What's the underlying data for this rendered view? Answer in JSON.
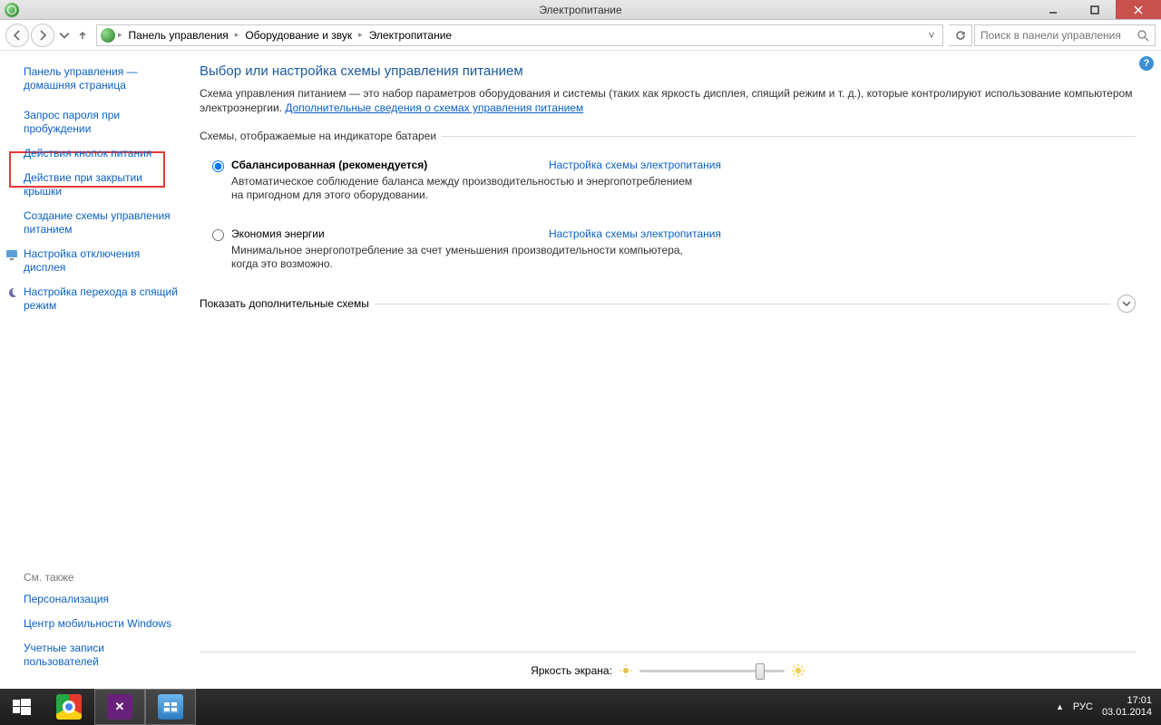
{
  "window": {
    "title": "Электропитание"
  },
  "breadcrumb": {
    "root": "Панель управления",
    "mid": "Оборудование и звук",
    "leaf": "Электропитание"
  },
  "search": {
    "placeholder": "Поиск в панели управления"
  },
  "sidebar": {
    "home": "Панель управления — домашняя страница",
    "items": [
      "Запрос пароля при пробуждении",
      "Действия кнопок питания",
      "Действие при закрытии крышки",
      "Создание схемы управления питанием",
      "Настройка отключения дисплея",
      "Настройка перехода в спящий режим"
    ],
    "see_also_hdr": "См. также",
    "see_also": [
      "Персонализация",
      "Центр мобильности Windows",
      "Учетные записи пользователей"
    ]
  },
  "main": {
    "title": "Выбор или настройка схемы управления питанием",
    "desc": "Схема управления питанием — это набор параметров оборудования и системы (таких как яркость дисплея, спящий режим и т. д.), которые контролируют использование компьютером электроэнергии.",
    "more_link": "Дополнительные сведения о схемах управления питанием",
    "legend": "Схемы, отображаемые на индикаторе батареи",
    "plans": [
      {
        "name": "Сбалансированная (рекомендуется)",
        "link": "Настройка схемы электропитания",
        "desc": "Автоматическое соблюдение баланса между производительностью и энергопотреблением на пригодном для этого оборудовании.",
        "selected": true
      },
      {
        "name": "Экономия энергии",
        "link": "Настройка схемы электропитания",
        "desc": "Минимальное энергопотребление за счет уменьшения производительности компьютера, когда это возможно.",
        "selected": false
      }
    ],
    "extra_label": "Показать дополнительные схемы",
    "brightness_label": "Яркость экрана:"
  },
  "taskbar": {
    "lang": "РУС",
    "time": "17:01",
    "date": "03.01.2014"
  }
}
